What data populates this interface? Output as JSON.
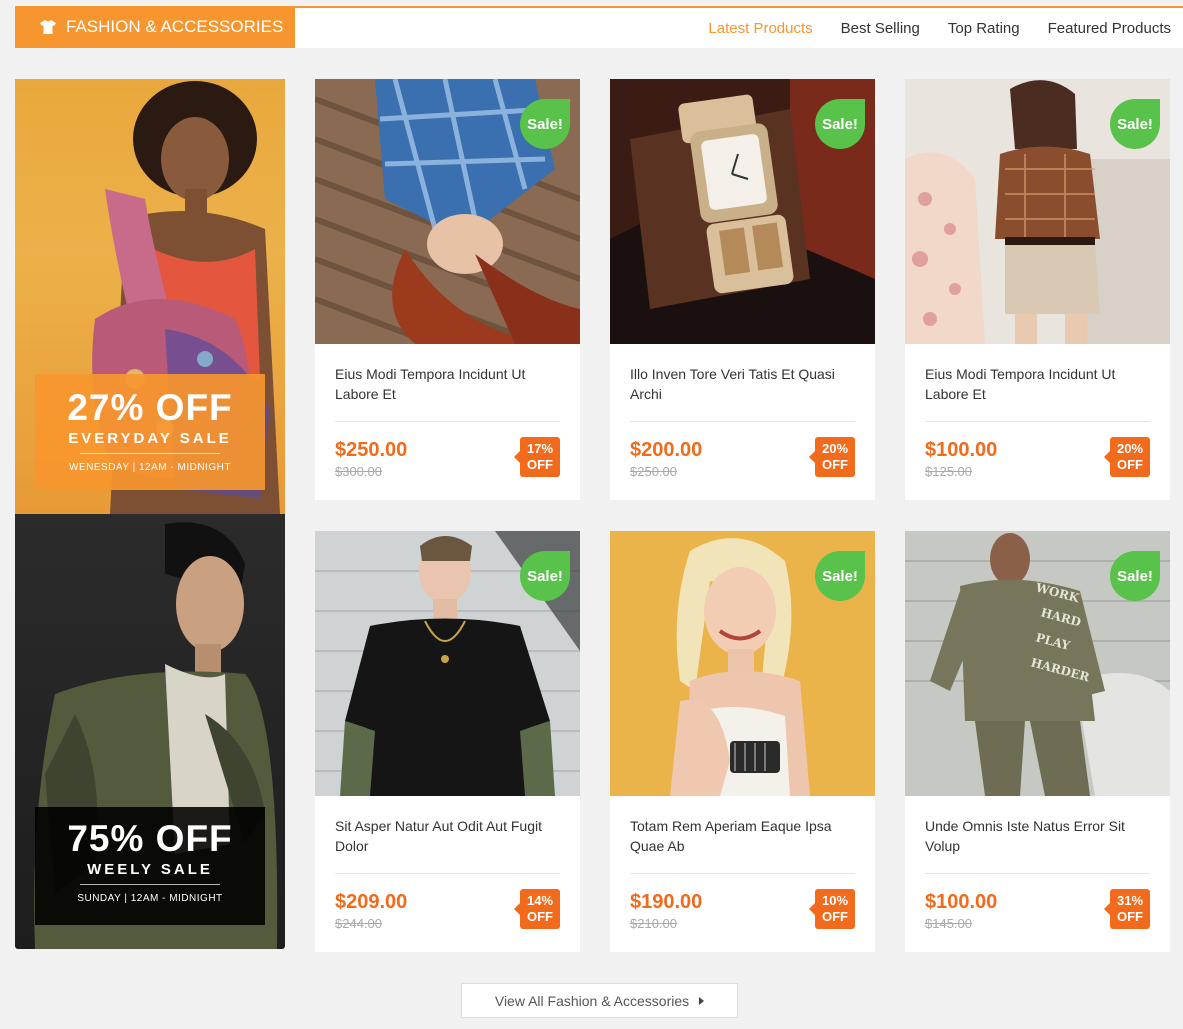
{
  "header": {
    "title": "FASHION & ACCESSORIES",
    "icon": "tshirt-icon",
    "tabs": [
      {
        "label": "Latest Products",
        "active": true
      },
      {
        "label": "Best Selling",
        "active": false
      },
      {
        "label": "Top Rating",
        "active": false
      },
      {
        "label": "Featured Products",
        "active": false
      }
    ]
  },
  "banners": [
    {
      "offer": "27% OFF",
      "subtitle": "EVERYDAY SALE",
      "time": "WENESDAY | 12AM - MIDNIGHT"
    },
    {
      "offer": "75% OFF",
      "subtitle": "WEELY SALE",
      "time": "SUNDAY | 12AM - MIDNIGHT"
    }
  ],
  "products": [
    {
      "name": "Eius Modi Tempora Incidunt Ut Labore Et",
      "price": "$250.00",
      "old_price": "$300.00",
      "discount_pct": "17%",
      "discount_label": "OFF",
      "badge": "Sale!"
    },
    {
      "name": "Illo Inven Tore Veri Tatis Et Quasi Archi",
      "price": "$200.00",
      "old_price": "$250.00",
      "discount_pct": "20%",
      "discount_label": "OFF",
      "badge": "Sale!"
    },
    {
      "name": "Eius Modi Tempora Incidunt Ut Labore Et",
      "price": "$100.00",
      "old_price": "$125.00",
      "discount_pct": "20%",
      "discount_label": "OFF",
      "badge": "Sale!"
    },
    {
      "name": "Sit Asper Natur Aut Odit Aut Fugit Dolor",
      "price": "$209.00",
      "old_price": "$244.00",
      "discount_pct": "14%",
      "discount_label": "OFF",
      "badge": "Sale!"
    },
    {
      "name": "Totam Rem Aperiam Eaque Ipsa Quae Ab",
      "price": "$190.00",
      "old_price": "$210.00",
      "discount_pct": "10%",
      "discount_label": "OFF",
      "badge": "Sale!"
    },
    {
      "name": "Unde Omnis Iste Natus Error Sit Volup",
      "price": "$100.00",
      "old_price": "$145.00",
      "discount_pct": "31%",
      "discount_label": "OFF",
      "badge": "Sale!"
    }
  ],
  "view_all": {
    "label": "View All Fashion & Accessories",
    "icon": "chevron-right-icon"
  },
  "colors": {
    "accent": "#f7962e",
    "price": "#f26a1b",
    "sale_badge": "#58c24a"
  }
}
